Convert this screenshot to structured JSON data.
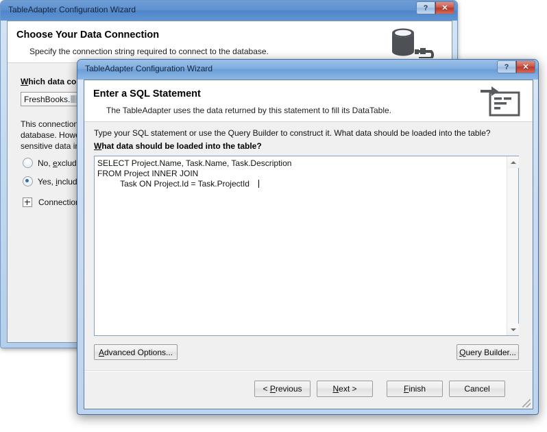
{
  "background_window": {
    "title": "TableAdapter Configuration Wizard",
    "header": {
      "title": "Choose Your Data Connection",
      "subtitle": "Specify the connection string required to connect to the database.",
      "icon": "database-connection-icon"
    },
    "controls": {
      "help_label": "?",
      "close_label": "✕"
    },
    "body": {
      "connection_label_accel": "W",
      "connection_label_rest": "hich data conn",
      "connection_value": "FreshBooks.",
      "paragraph_lines": [
        "This connection",
        "database. Howev",
        "sensitive data in"
      ],
      "radio_no": {
        "pre": "No, ",
        "accel": "e",
        "post": "xclude s",
        "checked": false
      },
      "radio_yes": {
        "pre": "Yes, ",
        "accel": "i",
        "post": "nclude s",
        "checked": true
      },
      "expander_label": "Connection "
    }
  },
  "foreground_window": {
    "title": "TableAdapter Configuration Wizard",
    "header": {
      "title": "Enter a SQL Statement",
      "subtitle": "The TableAdapter uses the data returned by this statement to fill its DataTable.",
      "icon": "sql-statement-icon"
    },
    "controls": {
      "help_label": "?",
      "close_label": "✕"
    },
    "body": {
      "hint": "Type your SQL statement or use the Query Builder to construct it. What data should be loaded into the table?",
      "question_accel": "W",
      "question_rest": "hat data should be loaded into the table?",
      "sql_text": "SELECT Project.Name, Task.Name, Task.Description\nFROM Project INNER JOIN\n          Task ON Project.Id = Task.ProjectId",
      "scrollbar": {
        "up_arrow": "scroll-up-arrow-icon",
        "down_arrow": "scroll-down-arrow-icon"
      }
    },
    "buttons": {
      "advanced_accel": "A",
      "advanced_rest": "dvanced Options...",
      "query_builder_accel": "Q",
      "query_builder_rest": "uery Builder...",
      "previous_pre": "< ",
      "previous_accel": "P",
      "previous_rest": "revious",
      "next_accel": "N",
      "next_rest": "ext >",
      "finish_accel": "F",
      "finish_rest": "inish",
      "cancel_label": "Cancel"
    }
  },
  "colors": {
    "title_active": "#7faddf",
    "title_inactive": "#5c90cf",
    "close_red": "#b8392b",
    "dialog_face": "#f0f0f0",
    "accent_blue": "#2c6fba"
  }
}
